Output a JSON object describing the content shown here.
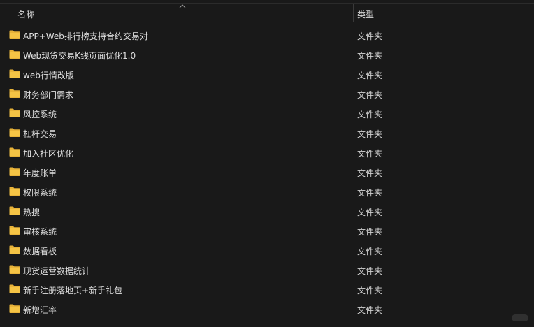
{
  "header": {
    "name_label": "名称",
    "type_label": "类型"
  },
  "colors": {
    "background": "#191919",
    "folder": "#e8b339",
    "text": "#e0e0e0"
  },
  "rows": [
    {
      "name": "APP+Web排行榜支持合约交易对",
      "type": "文件夹",
      "icon": "folder-icon"
    },
    {
      "name": "Web现货交易K线页面优化1.0",
      "type": "文件夹",
      "icon": "folder-icon"
    },
    {
      "name": "web行情改版",
      "type": "文件夹",
      "icon": "folder-icon"
    },
    {
      "name": "财务部门需求",
      "type": "文件夹",
      "icon": "folder-icon"
    },
    {
      "name": "风控系统",
      "type": "文件夹",
      "icon": "folder-icon"
    },
    {
      "name": "杠杆交易",
      "type": "文件夹",
      "icon": "folder-icon"
    },
    {
      "name": "加入社区优化",
      "type": "文件夹",
      "icon": "folder-icon"
    },
    {
      "name": "年度账单",
      "type": "文件夹",
      "icon": "folder-icon"
    },
    {
      "name": "权限系统",
      "type": "文件夹",
      "icon": "folder-icon"
    },
    {
      "name": "热搜",
      "type": "文件夹",
      "icon": "folder-icon"
    },
    {
      "name": "审核系统",
      "type": "文件夹",
      "icon": "folder-icon"
    },
    {
      "name": "数据看板",
      "type": "文件夹",
      "icon": "folder-icon"
    },
    {
      "name": "现货运营数据统计",
      "type": "文件夹",
      "icon": "folder-icon"
    },
    {
      "name": "新手注册落地页+新手礼包",
      "type": "文件夹",
      "icon": "folder-icon"
    },
    {
      "name": "新增汇率",
      "type": "文件夹",
      "icon": "folder-icon"
    }
  ]
}
